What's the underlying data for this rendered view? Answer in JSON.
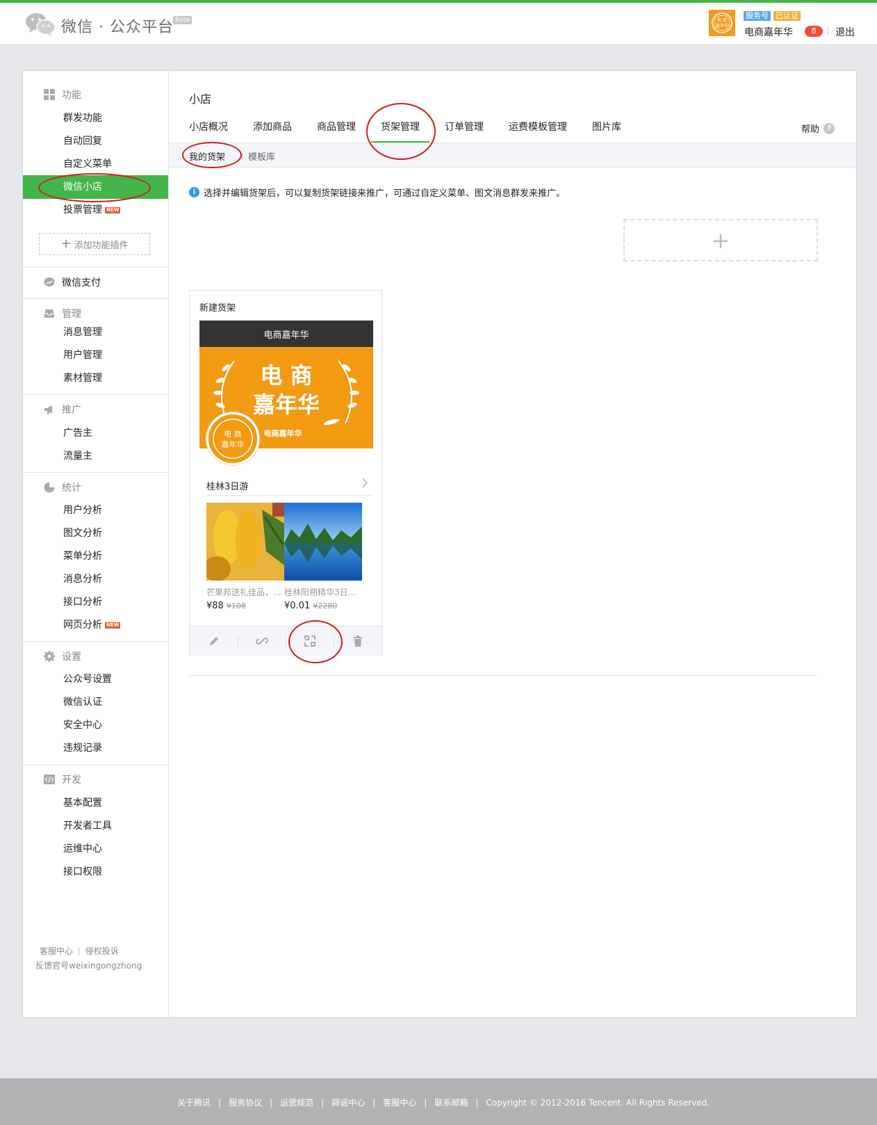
{
  "header": {
    "logo_text": "微信 · 公众平台",
    "beta_label": "Beta",
    "account_type_badge": "服务号",
    "verified_badge": "已认证",
    "account_name": "电商嘉年华",
    "unread_count": "8",
    "logout_label": "退出"
  },
  "sidebar": {
    "sections": {
      "features": {
        "title": "功能",
        "items": [
          "群发功能",
          "自动回复",
          "自定义菜单",
          "微信小店",
          "投票管理"
        ]
      },
      "add_plugin": "添加功能插件",
      "pay": {
        "title": "微信支付"
      },
      "manage": {
        "title": "管理",
        "items": [
          "消息管理",
          "用户管理",
          "素材管理"
        ]
      },
      "promote": {
        "title": "推广",
        "items": [
          "广告主",
          "流量主"
        ]
      },
      "stats": {
        "title": "统计",
        "items": [
          "用户分析",
          "图文分析",
          "菜单分析",
          "消息分析",
          "接口分析",
          "网页分析"
        ]
      },
      "settings": {
        "title": "设置",
        "items": [
          "公众号设置",
          "微信认证",
          "安全中心",
          "违规记录"
        ]
      },
      "dev": {
        "title": "开发",
        "items": [
          "基本配置",
          "开发者工具",
          "运维中心",
          "接口权限"
        ]
      }
    },
    "new_tag": "NEW",
    "active_item": "微信小店",
    "footer": {
      "support": "客服中心",
      "complaint": "侵权投诉",
      "feedback": "反馈官号weixingongzhong"
    }
  },
  "main": {
    "title": "小店",
    "tabs": [
      "小店概况",
      "添加商品",
      "商品管理",
      "货架管理",
      "订单管理",
      "运费模板管理",
      "图片库"
    ],
    "active_tab": "货架管理",
    "help_label": "帮助",
    "subtabs": [
      "我的货架",
      "模板库"
    ],
    "info_text": "选择并编辑货架后，可以复制货架链接来推广，可通过自定义菜单、图文消息群发来推广。",
    "shelf_card": {
      "title": "新建货架",
      "preview_header": "电商嘉年华",
      "banner_text_line1": "电 商",
      "banner_text_line2": "嘉年华",
      "banner_small_text": "电商嘉年华",
      "group_name": "桂林3日游",
      "products": [
        {
          "name": "芒果邦送礼佳品，...",
          "price": "¥88",
          "original_price": "¥108"
        },
        {
          "name": "桂林阳朔精华3日...",
          "price": "¥0.01",
          "original_price": "¥2280"
        }
      ],
      "actions": [
        "edit-icon",
        "link-icon",
        "qrcode-icon",
        "delete-icon"
      ]
    }
  },
  "footer": {
    "links": [
      "关于腾讯",
      "服务协议",
      "运营规范",
      "辟谣中心",
      "客服中心",
      "联系邮箱"
    ],
    "copyright": "Copyright © 2012-2016 Tencent. All Rights Reserved."
  },
  "colors": {
    "brand_green": "#44b549",
    "annotation_red": "#d11b1b",
    "banner_orange": "#f39a13"
  }
}
